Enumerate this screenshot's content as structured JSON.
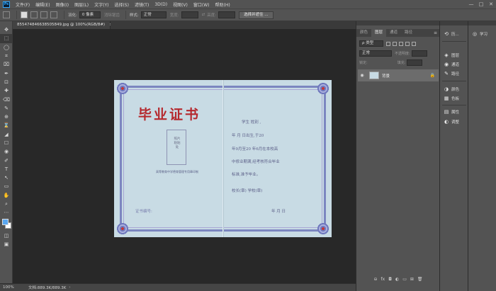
{
  "menu": {
    "logo": "Ps",
    "items": [
      "文件(F)",
      "编辑(E)",
      "图像(I)",
      "图层(L)",
      "文字(Y)",
      "选择(S)",
      "滤镜(T)",
      "3D(D)",
      "视图(V)",
      "窗口(W)",
      "帮助(H)"
    ],
    "minimize": "—",
    "maximize": "□",
    "close": "✕"
  },
  "options": {
    "feather_label": "羽化:",
    "feather_value": "0 像素",
    "antialias_label": "消除锯齿",
    "style_label": "样式:",
    "style_value": "正常",
    "width_label": "宽度:",
    "height_label": "高度:",
    "select_mask_button": "选择并遮住 ..."
  },
  "document": {
    "tab_title": "855474846638505849.jpg @ 100%(RGB/8#)",
    "close": "×"
  },
  "certificate": {
    "title": "毕业证书",
    "photo_label": "照片粘贴处",
    "issuer": "高等教育中学德育管理专用章印制",
    "serial_label": "证书编号:",
    "line1": "学生                姓别       ,",
    "line2": "    年  月  日出生,于20",
    "line3": "年9月至20    年6月在本校高",
    "line4": "中修业期满,经考核符合毕业",
    "line5": "标准,准予毕业。",
    "line6": "校长(章)           学校(章)",
    "date_line": "年   月   日"
  },
  "status": {
    "zoom": "100%",
    "doc_info": "文档:889.3K/889.3K",
    "arrow": "›"
  },
  "layers_panel": {
    "tabs": [
      "颜色",
      "图层",
      "通道",
      "路径"
    ],
    "active_tab": "图层",
    "menu": "≡",
    "filter_kind": "ρ 类型",
    "blend_mode": "正常",
    "opacity_label": "不透明度:",
    "lock_label": "锁定:",
    "fill_label": "填充:",
    "layer_name": "背景",
    "eye": "◉",
    "lock": "🔒",
    "footer_icons": [
      "⊖",
      "fx",
      "◘",
      "◐",
      "▭",
      "⊞",
      "🗑"
    ]
  },
  "dock": {
    "col1": [
      {
        "icon": "⟲",
        "label": "历..."
      },
      {
        "icon": "◈",
        "label": "图层"
      },
      {
        "icon": "◉",
        "label": "通道"
      },
      {
        "icon": "✎",
        "label": "路径"
      },
      {
        "icon": "◑",
        "label": "颜色"
      },
      {
        "icon": "▦",
        "label": "色板"
      },
      {
        "icon": "▤",
        "label": "属性"
      },
      {
        "icon": "◐",
        "label": "调整"
      }
    ],
    "col2": [
      {
        "icon": "◎",
        "label": "学习"
      }
    ]
  },
  "tools": [
    "✥",
    "⬚",
    "◯",
    "⌗",
    "⌧",
    "✒",
    "⊡",
    "✚",
    "⌫",
    "✎",
    "⊕",
    "⌛",
    "◢",
    "☐",
    "◉",
    "✐",
    "T",
    "↖",
    "▭",
    "✋",
    "⌕",
    "⋯"
  ],
  "colors": {
    "foreground": "#5aa7f0",
    "background": "#ffffff",
    "certificate_red": "#b5282d",
    "border_blue": "#7c86c0",
    "canvas_bg": "#282828",
    "ui_gray": "#535353"
  }
}
